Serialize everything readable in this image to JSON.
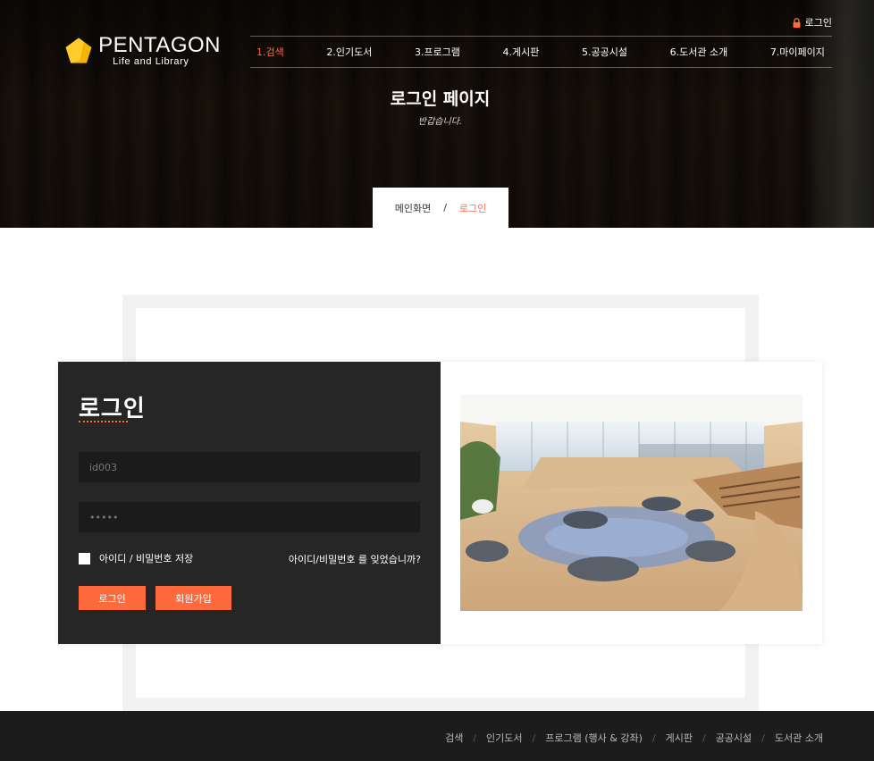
{
  "header": {
    "logo": {
      "title": "PENTAGON",
      "subtitle": "Life and Library"
    },
    "top_login_label": "로그인",
    "nav": [
      {
        "label": "1.검색",
        "active": true
      },
      {
        "label": "2.인기도서",
        "active": false
      },
      {
        "label": "3.프로그램",
        "active": false
      },
      {
        "label": "4.게시판",
        "active": false
      },
      {
        "label": "5.공공시설",
        "active": false
      },
      {
        "label": "6.도서관 소개",
        "active": false
      },
      {
        "label": "7.마이페이지",
        "active": false
      }
    ]
  },
  "hero": {
    "title": "로그인 페이지",
    "subtitle": "반갑습니다."
  },
  "breadcrumb": {
    "home": "메인화면",
    "separator": "/",
    "current": "로그인"
  },
  "login": {
    "heading": "로그인",
    "id_value": "id003",
    "password_value": "•••••",
    "remember_label": "아이디 / 비밀번호 저장",
    "forgot_label": "아이디/비밀번호 를 잊었습니까?",
    "login_button": "로그인",
    "signup_button": "회원가입",
    "accent_color": "#ff6a3d"
  },
  "footer": {
    "links": [
      "검색",
      "인기도서",
      "프로그램 (행사 & 강좌)",
      "게시판",
      "공공시설",
      "도서관 소개"
    ]
  }
}
